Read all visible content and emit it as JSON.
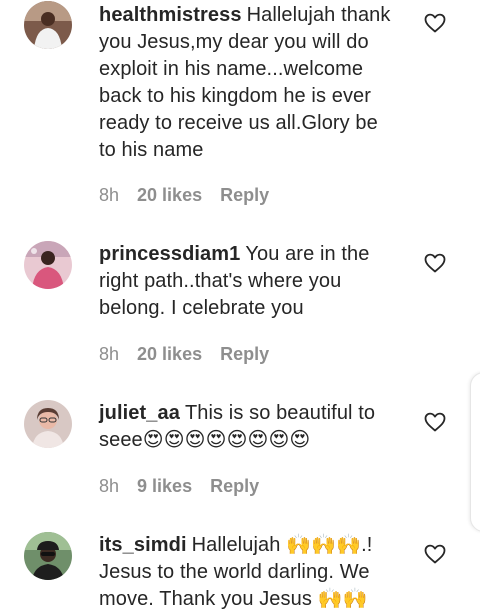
{
  "comments": [
    {
      "username": "healthmistress",
      "text": "Hallelujah thank you Jesus,my dear you will do exploit in his name...welcome back to his kingdom he is ever ready to receive us all.Glory be to his name",
      "time": "8h",
      "likes": "20 likes",
      "reply": "Reply",
      "avatar_icon": "profile-photo-woman-white-outfit"
    },
    {
      "username": "princessdiam1",
      "text": "You are in the right path..that's where you belong. I celebrate you",
      "time": "8h",
      "likes": "20 likes",
      "reply": "Reply",
      "avatar_icon": "profile-photo-woman-pink"
    },
    {
      "username": "juliet_aa",
      "text": "This is so beautiful to seee😍😍😍😍😍😍😍😍",
      "time": "8h",
      "likes": "9 likes",
      "reply": "Reply",
      "avatar_icon": "profile-photo-woman-glasses"
    },
    {
      "username": "its_simdi",
      "text": "Hallelujah 🙌🙌🙌.! Jesus to the world darling. We move. Thank you Jesus 🙌🙌",
      "time": "",
      "likes": "",
      "reply": "",
      "avatar_icon": "profile-photo-man-cap"
    }
  ],
  "colors": {
    "text": "#262626",
    "meta": "#8e8e8e"
  },
  "icons": {
    "like": "heart-outline-icon"
  }
}
